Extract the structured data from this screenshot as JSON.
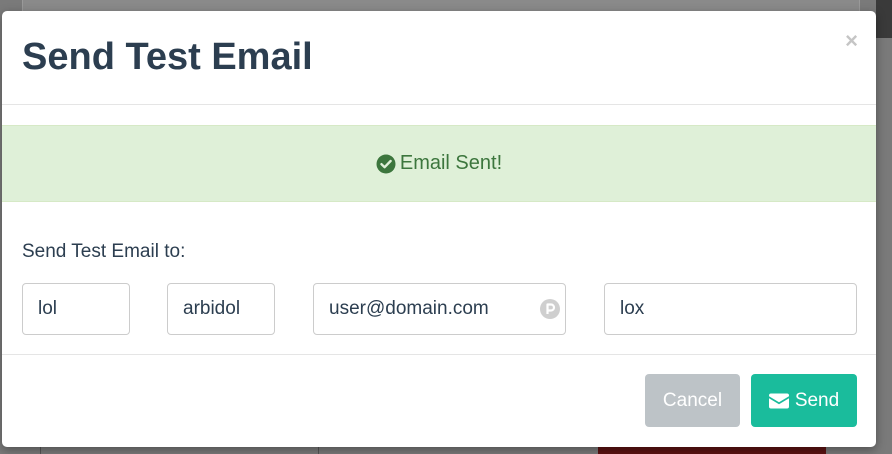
{
  "modal": {
    "title": "Send Test Email",
    "close_glyph": "×"
  },
  "alert": {
    "icon": "check-circle-icon",
    "message": "Email Sent!",
    "color": "#3c763d",
    "background": "#dff0d8"
  },
  "form": {
    "label": "Send Test Email to:",
    "first_name": "lol",
    "last_name": "arbidol",
    "email": "user@domain.com",
    "position": "lox"
  },
  "footer": {
    "cancel_label": "Cancel",
    "send_label": "Send",
    "send_icon": "envelope-icon"
  },
  "colors": {
    "title": "#2c3e50",
    "send_button": "#1abc9c",
    "cancel_button": "#bdc3c7"
  }
}
